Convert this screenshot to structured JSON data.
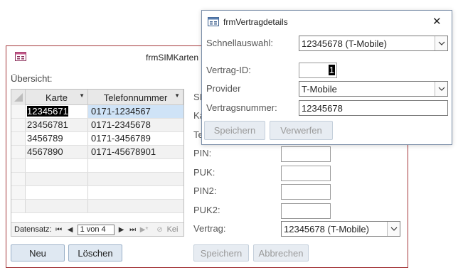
{
  "sim_window": {
    "title": "frmSIMKarten",
    "overview_label": "Übersicht:",
    "columns": [
      "Karte",
      "Telefonnummer"
    ],
    "rows": [
      {
        "karte": "12345671",
        "telefon": "0171-1234567"
      },
      {
        "karte": "23456781",
        "telefon": "0171-2345678"
      },
      {
        "karte": "3456789",
        "telefon": "0171-3456789"
      },
      {
        "karte": "4567890",
        "telefon": "0171-45678901"
      }
    ],
    "nav": {
      "label": "Datensatz:",
      "record": "1 von 4",
      "filter_text": "Kei"
    },
    "buttons": {
      "new": "Neu",
      "delete": "Löschen",
      "save": "Speichern",
      "cancel": "Abbrechen"
    },
    "detail_partial_labels": [
      "SI",
      "Ka",
      "Te"
    ],
    "labels": {
      "pin": "PIN:",
      "puk": "PUK:",
      "pin2": "PIN2:",
      "puk2": "PUK2:",
      "vertrag": "Vertrag:"
    },
    "vertrag_value": "12345678 (T-Mobile)"
  },
  "detail_window": {
    "title": "frmVertragdetails",
    "labels": {
      "quick": "Schnellauswahl:",
      "id": "Vertrag-ID:",
      "provider": "Provider",
      "number": "Vertragsnummer:"
    },
    "values": {
      "quick": "12345678 (T-Mobile)",
      "id": "1",
      "provider": "T-Mobile",
      "number": "12345678"
    },
    "buttons": {
      "save": "Speichern",
      "discard": "Verwerfen"
    },
    "close_glyph": "✕"
  },
  "icons": [
    "form-icon",
    "close-icon",
    "chevron-down-icon",
    "nav-first-icon",
    "nav-prev-icon",
    "nav-next-icon",
    "nav-last-icon",
    "nav-new-icon",
    "filter-icon"
  ]
}
